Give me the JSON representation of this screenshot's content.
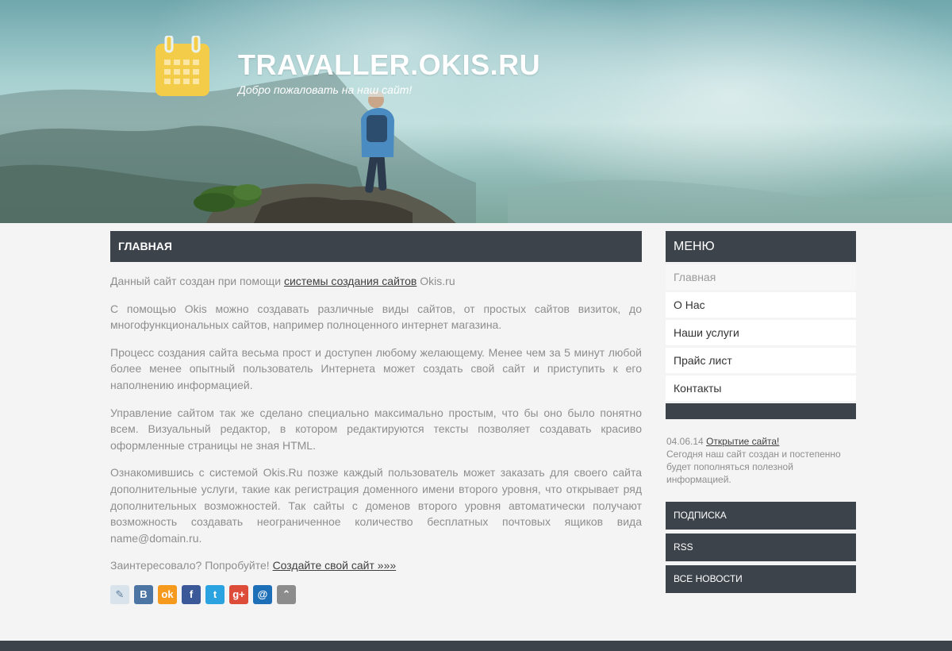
{
  "header": {
    "title": "TRAVALLER.OKIS.RU",
    "tagline": "Добро пожаловать на наш сайт!",
    "logo_icon": "calendar-icon",
    "logo_color": "#f3cd4a"
  },
  "main": {
    "heading": "ГЛАВНАЯ",
    "p1": {
      "before": "Данный сайт создан при помощи ",
      "link": "системы создания сайтов",
      "after": " Okis.ru"
    },
    "p2": "С помощью Okis можно создавать различные виды сайтов, от простых сайтов визиток, до многофункциональных сайтов, например полноценного интернет магазина.",
    "p3": "Процесс создания сайта весьма прост и доступен любому желающему. Менее чем за 5 минут любой более менее опытный пользователь Интернета может создать свой сайт и приступить к его наполнению информацией.",
    "p4": "Управление сайтом так же сделано специально максимально простым, что бы оно было понятно всем. Визуальный редактор, в котором редактируются тексты позволяет создавать красиво оформленные страницы не зная HTML.",
    "p5": "Ознакомившись с системой Okis.Ru позже каждый пользователь может заказать для своего сайта дополнительные услуги, такие как регистрация доменного имени второго уровня, что открывает ряд дополнительных возможностей. Так сайты с доменов второго уровня автоматически получают возможность создавать неограниченное количество бесплатных почтовых ящиков вида name@domain.ru.",
    "p6": {
      "before": "Заинтересовало? Попробуйте! ",
      "link": "Создайте свой сайт »»»"
    }
  },
  "share": [
    {
      "name": "livejournal-icon",
      "glyph": "✎",
      "color": "#d8e3ec"
    },
    {
      "name": "vkontakte-icon",
      "glyph": "B",
      "color": "#4c75a3"
    },
    {
      "name": "odnoklassniki-icon",
      "glyph": "ok",
      "color": "#f59a1d"
    },
    {
      "name": "facebook-icon",
      "glyph": "f",
      "color": "#3b5998"
    },
    {
      "name": "twitter-icon",
      "glyph": "t",
      "color": "#2aa3e0"
    },
    {
      "name": "google-plus-icon",
      "glyph": "g+",
      "color": "#dd4b39"
    },
    {
      "name": "mail-ru-icon",
      "glyph": "@",
      "color": "#1d6fb8"
    },
    {
      "name": "more-share-icon",
      "glyph": "⌃",
      "color": "#8c8c8c"
    }
  ],
  "sidebar": {
    "menu_title": "МЕНЮ",
    "items": [
      {
        "label": "Главная",
        "active": true
      },
      {
        "label": "О Нас"
      },
      {
        "label": "Наши услуги"
      },
      {
        "label": "Прайс лист"
      },
      {
        "label": "Контакты"
      }
    ],
    "news": {
      "date": "04.06.14",
      "title": "Открытие сайта!",
      "text": "Сегодня наш сайт создан и постепенно будет пополняться полезной информацией."
    },
    "buttons": [
      "ПОДПИСКА",
      "RSS",
      "ВСЕ НОВОСТИ"
    ]
  },
  "colors": {
    "dark_bar": "#3d434b",
    "page_bg": "#f4f4f4",
    "text": "#8e8e8e"
  }
}
